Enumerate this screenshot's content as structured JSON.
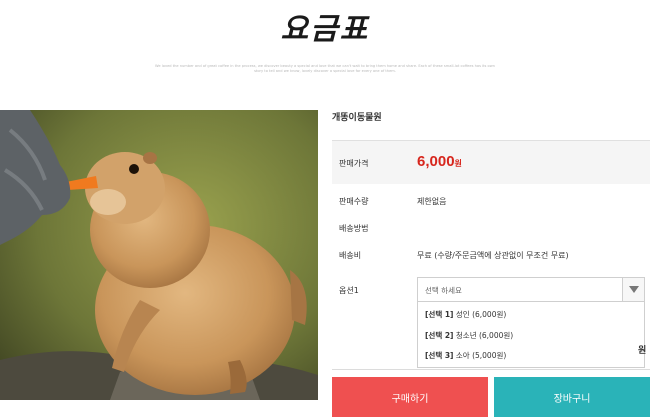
{
  "header": {
    "title": "요금표",
    "subtext": "We loved the number and of great coffee in the process, we discover beauty a special and love that we can't wait to bring them home and share. Each of these small-lot coffees has its own story to tell and we know, lovely discover a special love for every one of them."
  },
  "product": {
    "image_alt": "prairie-dog-photo",
    "name": "개똥이동물원",
    "price_label": "판매가격",
    "price_value": "6,000",
    "price_unit": "원",
    "qty_label": "판매수량",
    "qty_value": "제한없음",
    "shipping_method_label": "배송방법",
    "shipping_fee_label": "배송비",
    "shipping_fee_value": "무료 (수량/주문금액에 상관없이 무조건 무료)",
    "option_label": "옵션1",
    "option_placeholder": "선택 하세요",
    "options": [
      {
        "tag": "[선택 1]",
        "text": "성인 (6,000원)"
      },
      {
        "tag": "[선택 2]",
        "text": "청소년 (6,000원)"
      },
      {
        "tag": "[선택 3]",
        "text": "소아 (5,000원)"
      }
    ],
    "side_text": "원"
  },
  "actions": {
    "buy_label": "구매하기",
    "cart_label": "장바구니"
  },
  "colors": {
    "price": "#d7261d",
    "buy_button": "#ef5050",
    "cart_button": "#2ab3b8"
  }
}
